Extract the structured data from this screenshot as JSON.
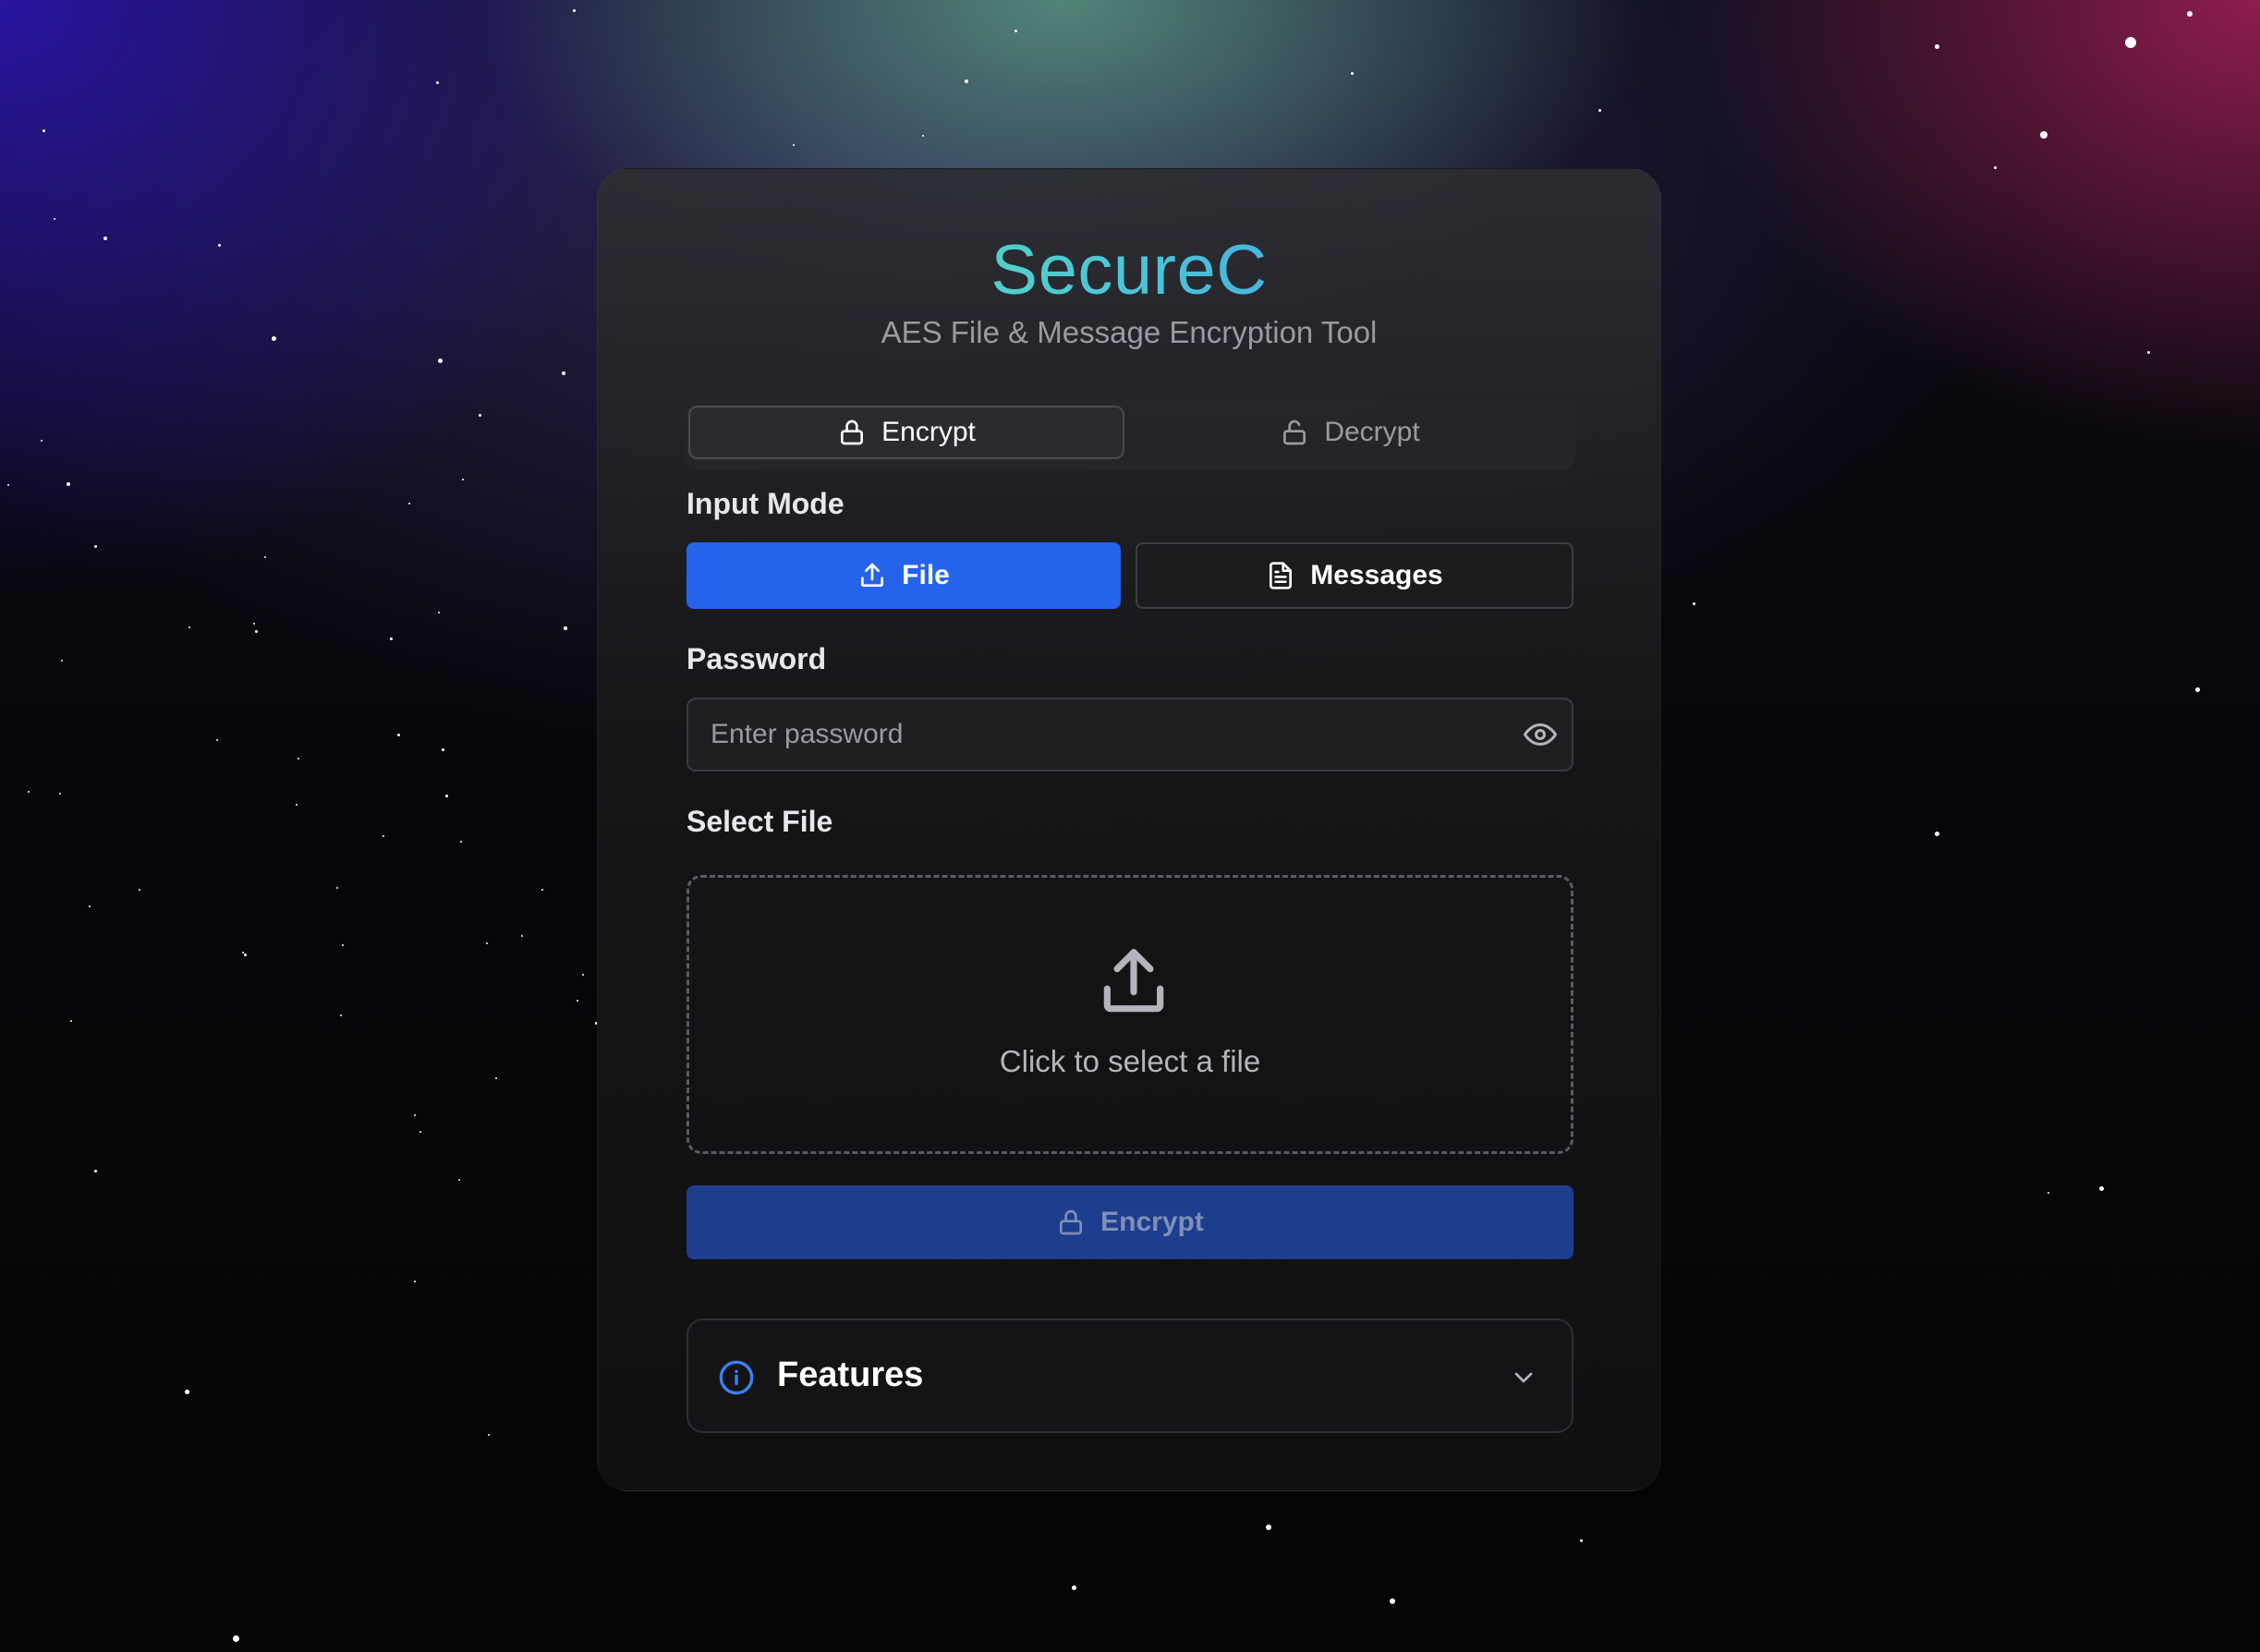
{
  "app": {
    "title": "SecureC",
    "subtitle": "AES File & Message Encryption Tool"
  },
  "tabs": [
    {
      "label": "Encrypt",
      "icon": "lock-icon",
      "active": true
    },
    {
      "label": "Decrypt",
      "icon": "unlock-icon",
      "active": false
    }
  ],
  "input_mode": {
    "label": "Input Mode",
    "options": [
      {
        "label": "File",
        "icon": "upload-icon",
        "selected": true
      },
      {
        "label": "Messages",
        "icon": "document-icon",
        "selected": false
      }
    ]
  },
  "password": {
    "label": "Password",
    "placeholder": "Enter password",
    "value": ""
  },
  "file_select": {
    "label": "Select File",
    "prompt": "Click to select a file"
  },
  "action": {
    "label": "Encrypt",
    "enabled": false
  },
  "features": {
    "title": "Features",
    "expanded": false
  },
  "colors": {
    "accent": "#2563eb",
    "action_disabled": "#1d3d8f",
    "title_gradient_start": "#5ee9a8",
    "title_gradient_end": "#3b82f6"
  }
}
